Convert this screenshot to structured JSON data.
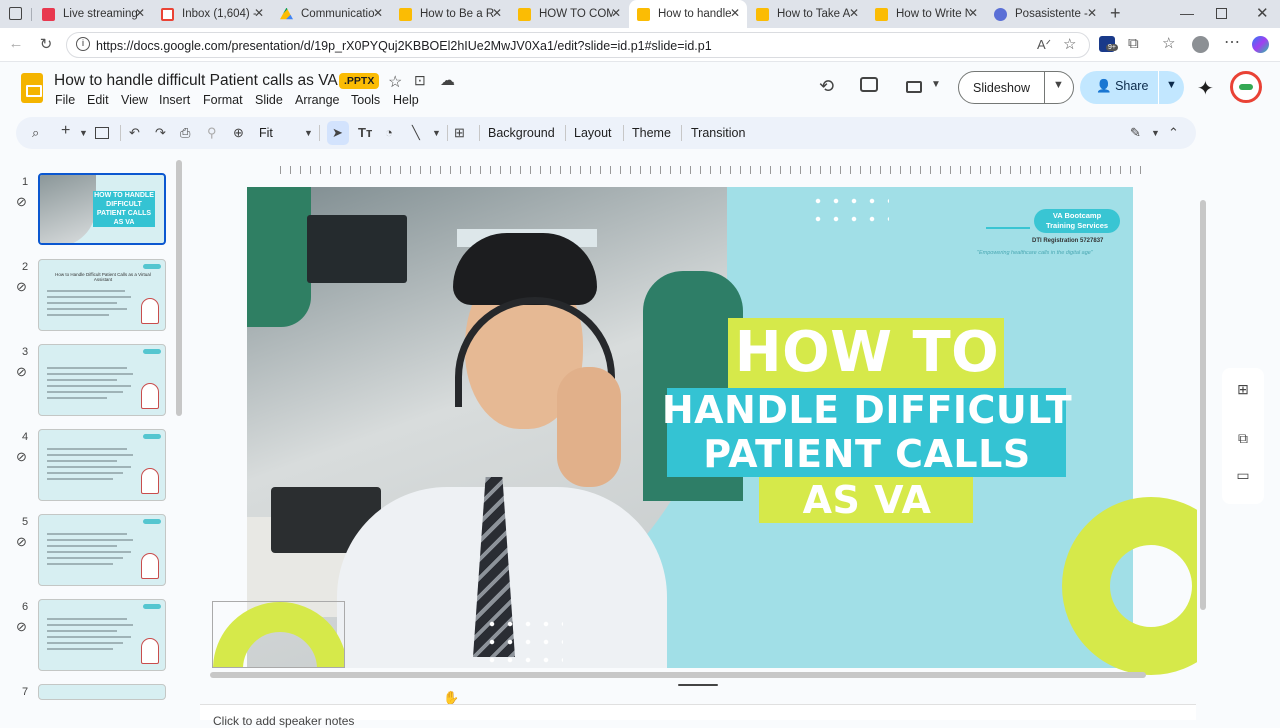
{
  "browser": {
    "tabs": [
      {
        "title": "Live streaming",
        "favicon_color": "#e8384f"
      },
      {
        "title": "Inbox (1,604) -",
        "favicon_color": "#ea4335"
      },
      {
        "title": "Communication",
        "favicon_color": "#4285f4"
      },
      {
        "title": "How to Be a Re",
        "favicon_color": "#fbbc04"
      },
      {
        "title": "HOW TO COM",
        "favicon_color": "#fbbc04"
      },
      {
        "title": "How to handle",
        "favicon_color": "#fbbc04",
        "active": true
      },
      {
        "title": "How to Take A",
        "favicon_color": "#fbbc04"
      },
      {
        "title": "How to Write N",
        "favicon_color": "#fbbc04"
      },
      {
        "title": "Posasistente -",
        "favicon_color": "#5a6fd6"
      }
    ],
    "url": "https://docs.google.com/presentation/d/19p_rX0PYQuj2KBBOEl2hIUe2MwJV0Xa1/edit?slide=id.p1#slide=id.p1",
    "extension_badge": "9+"
  },
  "doc": {
    "title": "How to handle difficult Patient calls as VA",
    "badge": ".PPTX",
    "menus": [
      "File",
      "Edit",
      "View",
      "Insert",
      "Format",
      "Slide",
      "Arrange",
      "Tools",
      "Help"
    ],
    "slideshow_label": "Slideshow",
    "share_label": "Share"
  },
  "toolbar": {
    "zoom": "Fit",
    "background": "Background",
    "layout": "Layout",
    "theme": "Theme",
    "transition": "Transition"
  },
  "filmstrip": {
    "slides": [
      "1",
      "2",
      "3",
      "4",
      "5",
      "6",
      "7"
    ],
    "thumb_titles": [
      "HOW TO HANDLE DIFFICULT PATIENT CALLS AS VA",
      "How to Handle Difficult Patient Calls as a Virtual Assistant"
    ]
  },
  "slide": {
    "headline_1": "HOW TO",
    "headline_2": "HANDLE DIFFICULT",
    "headline_3": "PATIENT CALLS",
    "headline_4": "AS VA",
    "brand_line1": "VA Bootcamp",
    "brand_line2": "Training Services",
    "brand_reg": "DTI Registration 5727837",
    "brand_tagline": "\"Empowering healthcare calls in the digital age\"",
    "colors": {
      "lime": "#d6e94a",
      "cyan": "#34c3d3",
      "background": "#a1dfe7"
    }
  },
  "notes": {
    "placeholder": "Click to add speaker notes"
  }
}
